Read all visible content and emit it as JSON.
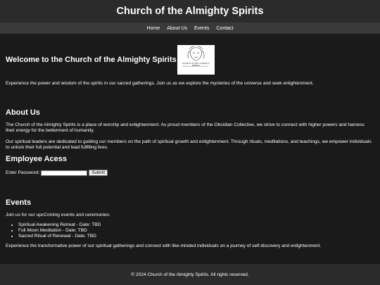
{
  "header": {
    "title": "Church of the Almighty Spirits"
  },
  "nav": {
    "items": [
      "Home",
      "About Us",
      "Events",
      "Contact"
    ]
  },
  "welcome": {
    "heading": "Welcome to the Church of the Almighty Spirits",
    "logo_text": "CHURCH OF THE ALMIGHTY SPIRITS",
    "logo_subtext": "EMBRACE AND SEEK THE SPIRITS",
    "intro": "Experience the power and wisdom of the spirits in our sacred gatherings. Join us as we explore the mysteries of the universe and seek enlightenment."
  },
  "about": {
    "heading": "About Us",
    "p1": "The Church of the Almighty Spirits is a place of worship and enlightenment. As proud members of the Obsidian Collective, we strive to connect with higher powers and harness their energy for the betterment of humanity.",
    "p2": "Our spiritual leaders are dedicated to guiding our members on the path of spiritual growth and enlightenment. Through rituals, meditations, and teachings, we empower individuals to unlock their full potential and lead fulfilling lives."
  },
  "employee": {
    "heading": "Employee Acess",
    "password_label": "Enter Password:",
    "password_value": "",
    "submit_label": "Submit"
  },
  "events": {
    "heading": "Events",
    "intro": "Join us for our upcComing events and ceremonies:",
    "items": [
      "Spiritual Awakening Retreat - Date: TBD",
      "Full Moon Meditation - Date: TBD",
      "Sacred Ritual of Renewal - Date: TBD"
    ],
    "outro": "Experience the transformative power of our spiritual gatherings and connect with like-minded individuals on a journey of self-discovery and enlightenment."
  },
  "footer": {
    "text": "© 2024 Church of the Almighty Spirits. All rights reserved."
  },
  "colors": {
    "page_bg": "#1a1a1a",
    "header_bg": "#2b2b2b",
    "nav_bg": "#3a3a3a",
    "text": "#ffffff"
  }
}
